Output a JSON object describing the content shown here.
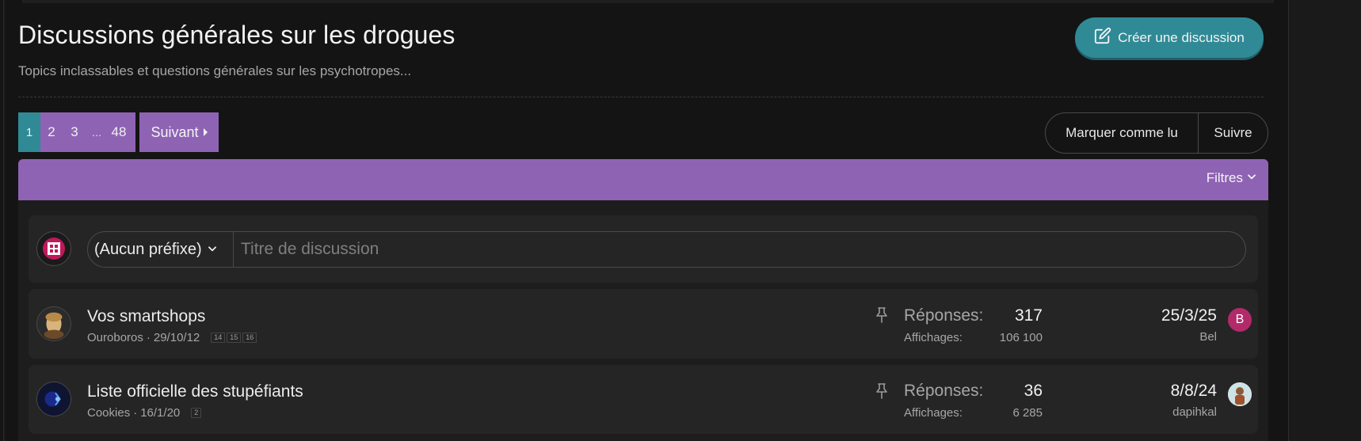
{
  "header": {
    "title": "Discussions générales sur les drogues",
    "description": "Topics inclassables et questions générales sur les psychotropes...",
    "create_button": "Créer une discussion"
  },
  "pagination": {
    "pages": [
      "1",
      "2",
      "3",
      "…",
      "48"
    ],
    "current": "1",
    "next_label": "Suivant"
  },
  "actions": {
    "mark_read": "Marquer comme lu",
    "follow": "Suivre"
  },
  "filters": {
    "label": "Filtres"
  },
  "quick_thread": {
    "prefix": "(Aucun préfixe)",
    "placeholder": "Titre de discussion"
  },
  "threads": [
    {
      "title": "Vos smartshops",
      "author": "Ouroboros",
      "separator": "·",
      "date": "29/10/12",
      "pages": [
        "14",
        "15",
        "16"
      ],
      "pinned": true,
      "replies_label": "Réponses:",
      "replies": "317",
      "views_label": "Affichages:",
      "views": "106 100",
      "last_date": "25/3/25",
      "last_user": "Bel",
      "last_user_initial": "B"
    },
    {
      "title": "Liste officielle des stupéfiants",
      "author": "Cookies",
      "separator": "·",
      "date": "16/1/20",
      "pages": [
        "2"
      ],
      "pinned": true,
      "replies_label": "Réponses:",
      "replies": "36",
      "views_label": "Affichages:",
      "views": "6 285",
      "last_date": "8/8/24",
      "last_user": "dapihkal",
      "last_user_initial": ""
    }
  ],
  "colors": {
    "accent_teal": "#2f8a96",
    "accent_purple": "#8e63b4",
    "avatar_pink": "#b32a6a"
  },
  "icons": {
    "create": "edit-icon",
    "pin": "pin-icon",
    "dropdown": "chevron-down-icon"
  }
}
